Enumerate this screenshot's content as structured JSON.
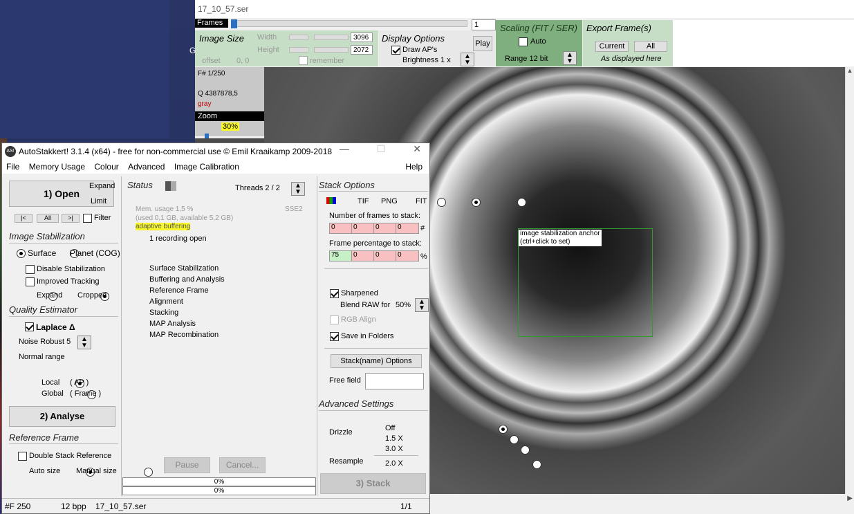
{
  "viewer": {
    "title": "17_10_57.ser",
    "frames_label": "Frames",
    "frame_value": "1",
    "image_size": {
      "label": "Image Size",
      "width_label": "Width",
      "width": "3096",
      "height_label": "Height",
      "height": "2072",
      "offset_label": "offset",
      "offset": "0, 0",
      "remember": "remember"
    },
    "display_options": {
      "label": "Display Options",
      "draw_aps": "Draw AP's",
      "play": "Play",
      "brightness": "Brightness  1 x"
    },
    "scaling": {
      "label": "Scaling (FIT / SER)",
      "auto": "Auto",
      "range": "Range 12 bit"
    },
    "export": {
      "label": "Export Frame(s)",
      "current": "Current",
      "all": "All",
      "as_displayed": "As displayed here"
    },
    "info": {
      "frame": "F# 1/250",
      "quality": "Q  4387878,5",
      "mode": "gray"
    },
    "zoom_label": "Zoom",
    "zoom_value": "30%",
    "anchor_label_1": "image stabilization anchor",
    "anchor_label_2": "(ctrl+click to set)",
    "partial_letter": "G"
  },
  "dialog": {
    "title": "AutoStakkert! 3.1.4 (x64) - free for non-commercial use © Emil Kraaikamp 2009-2018",
    "icon": "AS!",
    "menu": [
      "File",
      "Memory Usage",
      "Colour",
      "Advanced",
      "Image Calibration"
    ],
    "help": "Help",
    "open": "1) Open",
    "expand": "Expand",
    "limit": "Limit",
    "nav_prev": "|<",
    "nav_all": "All",
    "nav_next": ">|",
    "filter": "Filter",
    "image_stabilization": "Image Stabilization",
    "surface": "Surface",
    "planet": "Planet (COG)",
    "disable_stab": "Disable Stabilization",
    "improved_tracking": "Improved Tracking",
    "expand_opt": "Expand",
    "cropped": "Cropped",
    "quality_estimator": "Quality Estimator",
    "laplace": "Laplace Δ",
    "noise_robust": "Noise Robust  5",
    "normal_range": "Normal range",
    "local": "Local",
    "local_ap": "( AP )",
    "global": "Global",
    "global_frame": "( Frame )",
    "analyse": "2) Analyse",
    "reference_frame": "Reference Frame",
    "double_stack": "Double Stack Reference",
    "auto_size": "Auto size",
    "manual_size": "Manual size",
    "status": "Status",
    "threads": "Threads 2 / 2",
    "mem_usage": "Mem. usage 1,5 %",
    "mem_detail": "(used 0,1 GB, available 5,2 GB)",
    "sse": "SSE2",
    "adaptive": "adaptive buffering",
    "recording": "1 recording open",
    "steps": [
      "Surface Stabilization",
      "Buffering and Analysis",
      "Reference Frame",
      "Alignment",
      "Stacking",
      "MAP Analysis",
      "MAP Recombination"
    ],
    "pause": "Pause",
    "cancel": "Cancel...",
    "progress1": "0%",
    "progress2": "0%",
    "stack_options": "Stack Options",
    "tif": "TIF",
    "png": "PNG",
    "fit": "FIT",
    "num_frames_label": "Number of frames to stack:",
    "num_frames": [
      "0",
      "0",
      "0",
      "0"
    ],
    "hash": "#",
    "frame_pct_label": "Frame percentage to stack:",
    "frame_pct": [
      "75",
      "0",
      "0",
      "0"
    ],
    "pct": "%",
    "sharpened": "Sharpened",
    "blend_raw": "Blend RAW for",
    "blend_value": "50%",
    "rgb_align": "RGB Align",
    "save_folders": "Save in Folders",
    "stackname": "Stack(name) Options",
    "free_field": "Free field",
    "advanced_settings": "Advanced Settings",
    "drizzle": "Drizzle",
    "off": "Off",
    "d15": "1.5 X",
    "d30": "3.0 X",
    "resample": "Resample",
    "r20": "2.0 X",
    "stack": "3) Stack",
    "status_frames": "#F 250",
    "status_bpp": "12 bpp",
    "status_file": "17_10_57.ser",
    "status_page": "1/1"
  },
  "colors": {
    "accent_green": "#c6dec6",
    "highlight": "#f7f72a",
    "pink": "#f8c0c0"
  }
}
